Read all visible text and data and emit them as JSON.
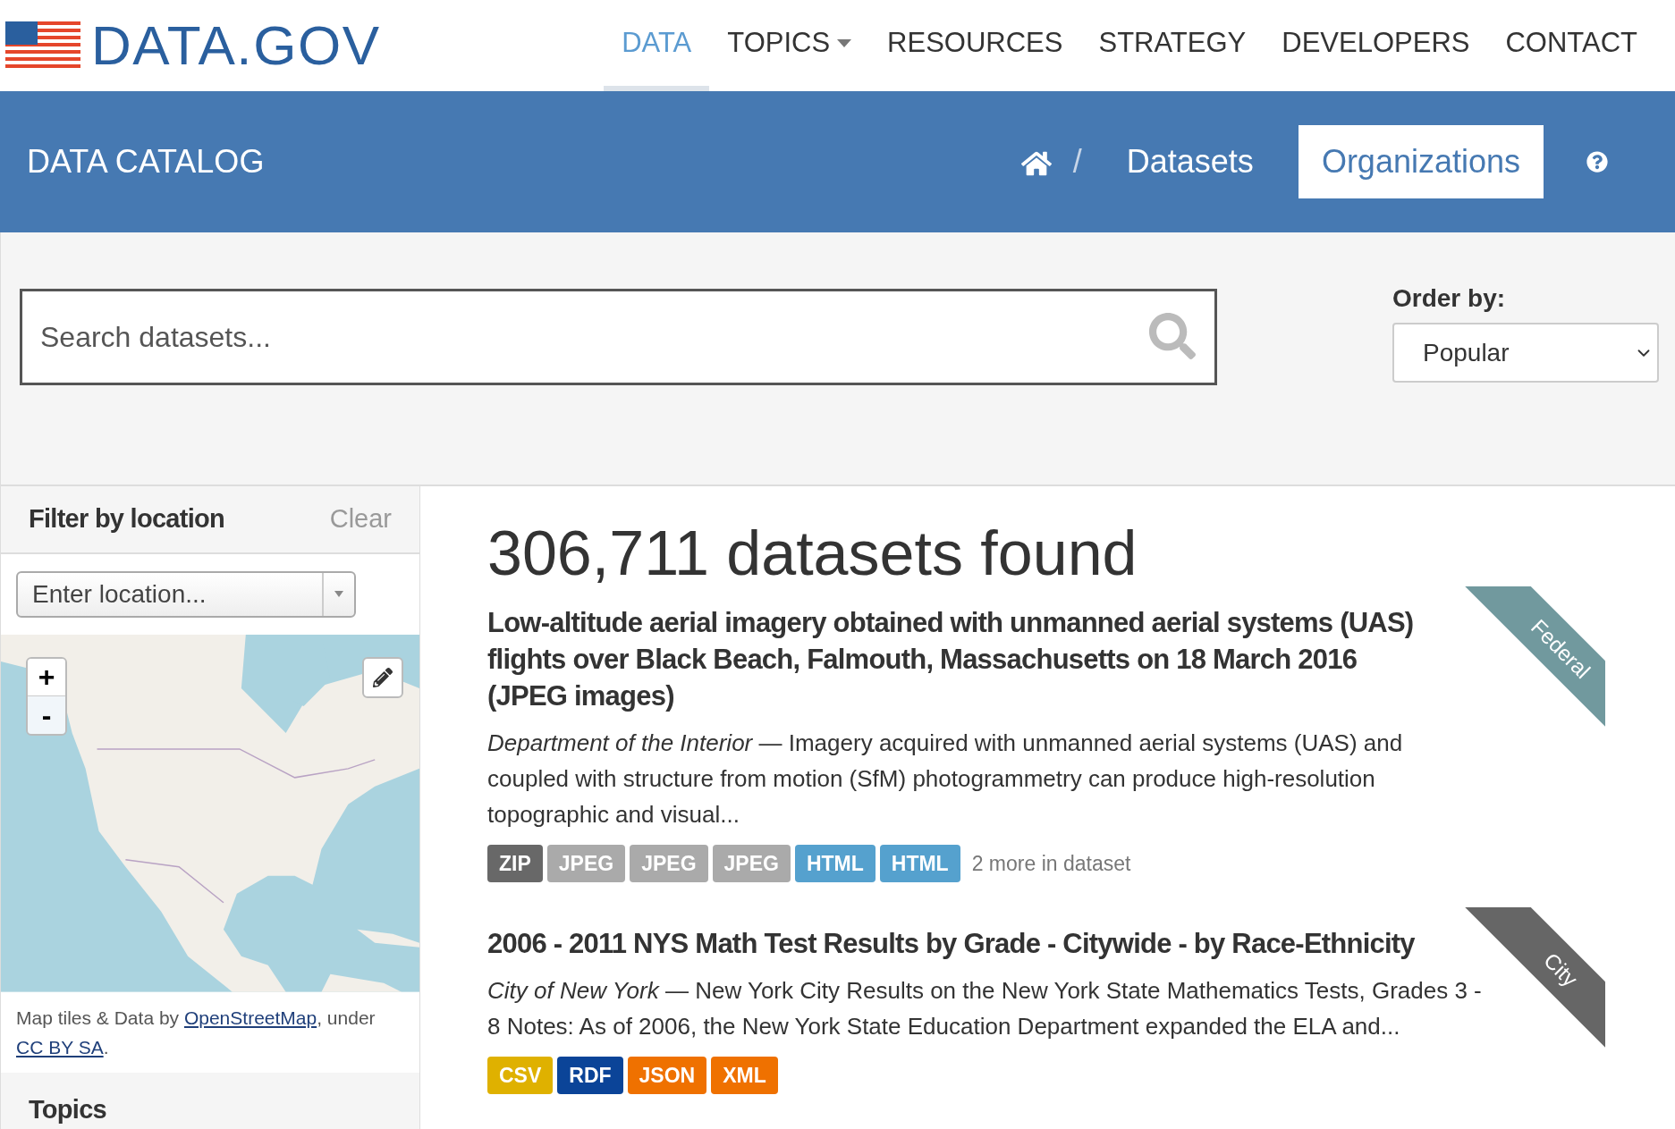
{
  "header": {
    "logo": "DATA.GOV",
    "nav": [
      {
        "label": "DATA",
        "selected": true,
        "dropdown": false
      },
      {
        "label": "TOPICS",
        "selected": false,
        "dropdown": true
      },
      {
        "label": "RESOURCES",
        "selected": false,
        "dropdown": false
      },
      {
        "label": "STRATEGY",
        "selected": false,
        "dropdown": false
      },
      {
        "label": "DEVELOPERS",
        "selected": false,
        "dropdown": false
      },
      {
        "label": "CONTACT",
        "selected": false,
        "dropdown": false
      }
    ]
  },
  "catalog_bar": {
    "title": "DATA CATALOG",
    "home_separator": "/",
    "breadcrumb": [
      {
        "label": "Datasets",
        "selected": false
      },
      {
        "label": "Organizations",
        "selected": true
      }
    ]
  },
  "search": {
    "placeholder": "Search datasets..."
  },
  "order_by": {
    "label": "Order by:",
    "value": "Popular"
  },
  "filter": {
    "title": "Filter by location",
    "clear": "Clear",
    "location": {
      "placeholder": "Enter location..."
    },
    "zoom_in": "+",
    "zoom_out": "-",
    "attribution": [
      {
        "text": "Map tiles & Data by ",
        "link": false
      },
      {
        "text": "OpenStreetMap",
        "link": true
      },
      {
        "text": ", under ",
        "link": false
      },
      {
        "text": "CC BY SA",
        "link": true
      },
      {
        "text": ".",
        "link": false
      }
    ]
  },
  "topics_title": "Topics",
  "results": {
    "count": "306,711 datasets found",
    "datasets": [
      {
        "title": "Low-altitude aerial imagery obtained with unmanned aerial systems (UAS) flights over Black Beach, Falmouth, Massachusetts on 18 March 2016 (JPEG images)",
        "publisher": "Department of the Interior",
        "separator": "—",
        "description": "Imagery acquired with unmanned aerial systems (UAS) and coupled with structure from motion (SfM) photogrammetry can produce high-resolution topographic and visual...",
        "ribbon": {
          "label": "Federal",
          "color": "#71999e"
        },
        "formats": [
          {
            "label": "ZIP",
            "color": "#686868"
          },
          {
            "label": "JPEG",
            "color": "#aaaaaa"
          },
          {
            "label": "JPEG",
            "color": "#aaaaaa"
          },
          {
            "label": "JPEG",
            "color": "#aaaaaa"
          },
          {
            "label": "HTML",
            "color": "#55a1ce"
          },
          {
            "label": "HTML",
            "color": "#55a1ce"
          }
        ],
        "more": "2 more in dataset"
      },
      {
        "title": "2006 - 2011 NYS Math Test Results by Grade - Citywide - by Race-Ethnicity",
        "publisher": "City of New York",
        "separator": "—",
        "description": "New York City Results on the New York State Mathematics Tests, Grades 3 - 8 Notes: As of 2006, the New York State Education Department expanded the ELA and...",
        "ribbon": {
          "label": "City",
          "color": "#666666"
        },
        "formats": [
          {
            "label": "CSV",
            "color": "#dfb100"
          },
          {
            "label": "RDF",
            "color": "#0b4498"
          },
          {
            "label": "JSON",
            "color": "#ef7100"
          },
          {
            "label": "XML",
            "color": "#ef7100"
          }
        ]
      }
    ]
  }
}
